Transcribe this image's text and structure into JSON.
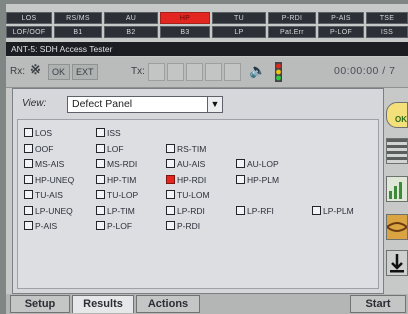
{
  "alarm_leds": {
    "row1": [
      "LOS",
      "RS/MS",
      "AU",
      "HP",
      "TU",
      "P-RDI",
      "P-AIS",
      "TSE"
    ],
    "row2": [
      "LOF/OOF",
      "B1",
      "B2",
      "B3",
      "LP",
      "Pat.Err",
      "P-LOF",
      "ISS"
    ],
    "active": "HP",
    "active_color": "#e3261f"
  },
  "window_title": "ANT-5: SDH Access Tester",
  "toolbar": {
    "rx_label": "Rx:",
    "rx_clock": "OK",
    "rx_ext": "EXT",
    "tx_label": "Tx:",
    "timer": "00:00:00 / 7"
  },
  "view": {
    "label": "View:",
    "selected": "Defect Panel"
  },
  "defects": [
    [
      "LOS",
      "ISS"
    ],
    [
      "OOF",
      "LOF",
      "RS-TIM"
    ],
    [
      "MS-AIS",
      "MS-RDI",
      "AU-AIS",
      "AU-LOP"
    ],
    [
      "HP-UNEQ",
      "HP-TIM",
      "HP-RDI",
      "HP-PLM"
    ],
    [
      "TU-AIS",
      "TU-LOP",
      "TU-LOM"
    ],
    [
      "LP-UNEQ",
      "LP-TIM",
      "LP-RDI",
      "LP-RFI",
      "LP-PLM"
    ],
    [
      "P-AIS",
      "P-LOF",
      "P-RDI"
    ]
  ],
  "active_defect": "HP-RDI",
  "side_icons": [
    "status-ok-icon",
    "stripes-icon",
    "chart-icon",
    "cable-icon",
    "download-icon"
  ],
  "side_ok": "OK",
  "tabs": {
    "setup": "Setup",
    "results": "Results",
    "actions": "Actions",
    "start": "Start"
  }
}
